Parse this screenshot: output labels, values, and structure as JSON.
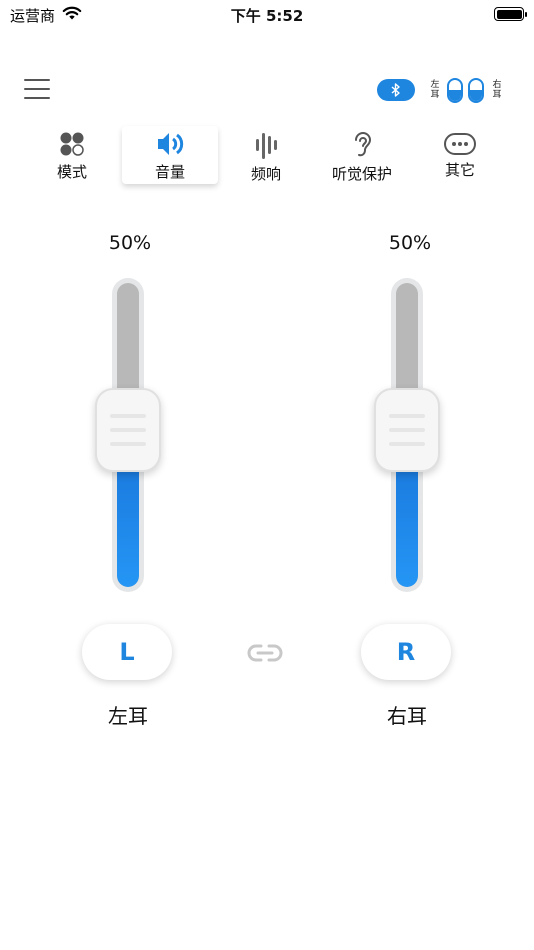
{
  "status_bar": {
    "carrier": "运营商",
    "time": "下午 5:52"
  },
  "header": {
    "menu_icon": "hamburger-menu-icon",
    "bluetooth_icon": "bluetooth-icon",
    "left_ear_tag": "左\n耳",
    "right_ear_tag": "右\n耳",
    "accent_color": "#1f86e0"
  },
  "tabs": [
    {
      "label": "模式",
      "icon": "mode-dots-icon",
      "active": false
    },
    {
      "label": "音量",
      "icon": "speaker-volume-icon",
      "active": true
    },
    {
      "label": "频响",
      "icon": "frequency-bars-icon",
      "active": false
    },
    {
      "label": "听觉保护",
      "icon": "ear-icon",
      "active": false
    },
    {
      "label": "其它",
      "icon": "more-dots-icon",
      "active": false
    }
  ],
  "left_channel": {
    "percent_text": "50%",
    "level": 0.5,
    "button_label": "L",
    "ear_label": "左耳"
  },
  "right_channel": {
    "percent_text": "50%",
    "level": 0.5,
    "button_label": "R",
    "ear_label": "右耳"
  },
  "link_icon": "link-chain-icon"
}
